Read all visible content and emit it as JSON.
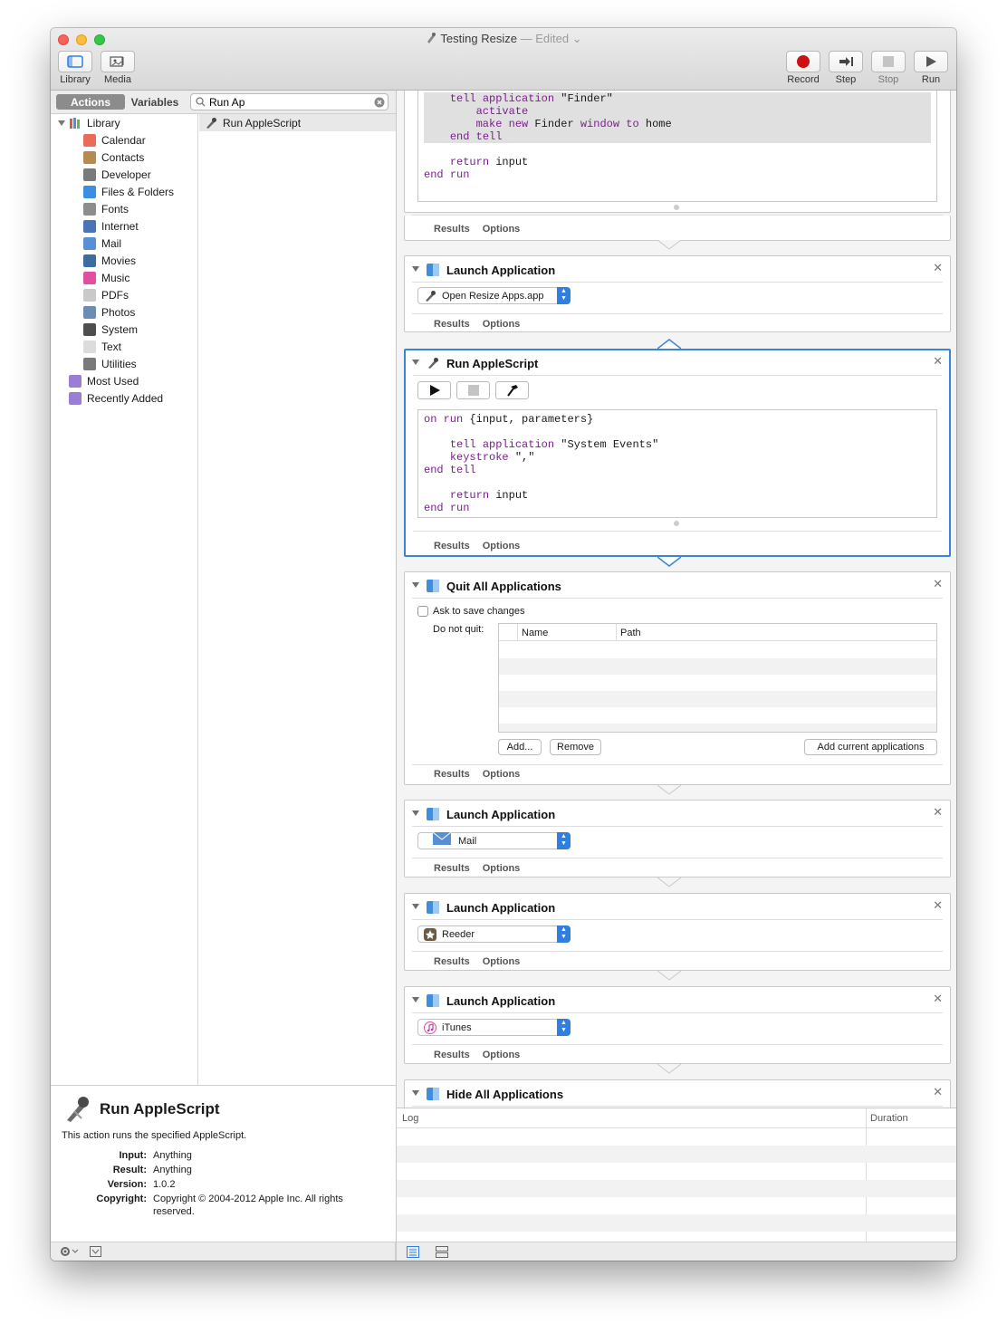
{
  "window": {
    "title": "Testing Resize",
    "edited_label": "— Edited",
    "edited_chevron": "⌄"
  },
  "toolbar": {
    "library_label": "Library",
    "media_label": "Media",
    "record_label": "Record",
    "step_label": "Step",
    "stop_label": "Stop",
    "run_label": "Run",
    "record_color": "#cc1111"
  },
  "left_header": {
    "actions_tab": "Actions",
    "variables_tab": "Variables",
    "search_value": "Run Ap"
  },
  "library": {
    "root_label": "Library",
    "items": [
      {
        "label": "Calendar",
        "icon": "calendar-icon",
        "color": "#e96c5a"
      },
      {
        "label": "Contacts",
        "icon": "contacts-icon",
        "color": "#b68a53"
      },
      {
        "label": "Developer",
        "icon": "developer-icon",
        "color": "#7a7a7a"
      },
      {
        "label": "Files & Folders",
        "icon": "finder-icon",
        "color": "#3c8ee0"
      },
      {
        "label": "Fonts",
        "icon": "fonts-icon",
        "color": "#8d8d8d"
      },
      {
        "label": "Internet",
        "icon": "internet-icon",
        "color": "#4a74b8"
      },
      {
        "label": "Mail",
        "icon": "mail-icon",
        "color": "#5a8fd6"
      },
      {
        "label": "Movies",
        "icon": "movies-icon",
        "color": "#3d6d9e"
      },
      {
        "label": "Music",
        "icon": "music-icon",
        "color": "#e24fa0"
      },
      {
        "label": "PDFs",
        "icon": "pdf-icon",
        "color": "#c9c9c9"
      },
      {
        "label": "Photos",
        "icon": "photos-icon",
        "color": "#6b8db4"
      },
      {
        "label": "System",
        "icon": "system-icon",
        "color": "#4e4e4e"
      },
      {
        "label": "Text",
        "icon": "text-icon",
        "color": "#dcdcdc"
      },
      {
        "label": "Utilities",
        "icon": "utilities-icon",
        "color": "#7a7a7a"
      }
    ],
    "smart_groups": [
      {
        "label": "Most Used",
        "icon": "smart-folder-icon",
        "color": "#9a7ed6"
      },
      {
        "label": "Recently Added",
        "icon": "smart-folder-icon",
        "color": "#9a7ed6"
      }
    ]
  },
  "actions_list": [
    {
      "label": "Run AppleScript",
      "icon": "applescript-icon"
    }
  ],
  "description": {
    "title": "Run AppleScript",
    "text": "This action runs the specified AppleScript.",
    "input_key": "Input:",
    "input_val": "Anything",
    "result_key": "Result:",
    "result_val": "Anything",
    "version_key": "Version:",
    "version_val": "1.0.2",
    "copyright_key": "Copyright:",
    "copyright_val_1": "Copyright © 2004-2012 Apple Inc.  All rights",
    "copyright_val_2": "reserved."
  },
  "workflow": {
    "results_label": "Results",
    "options_label": "Options",
    "card0": {
      "code": [
        {
          "t": "    tell application \"Finder\"",
          "hl": true
        },
        {
          "t": "        activate",
          "hl": true
        },
        {
          "t": "        make new Finder window to home",
          "hl": true
        },
        {
          "t": "    end tell",
          "hl": true
        },
        {
          "t": "",
          "hl": false
        },
        {
          "t": "    return input",
          "hl": false
        },
        {
          "t": "end run",
          "hl": false
        }
      ]
    },
    "card1": {
      "title": "Launch Application",
      "app": "Open Resize Apps.app"
    },
    "card2": {
      "title": "Run AppleScript",
      "code": [
        "on run {input, parameters}",
        "",
        "    tell application \"System Events\"",
        "    keystroke \",\"",
        "end tell",
        "",
        "    return input",
        "end run"
      ]
    },
    "card3": {
      "title": "Quit All Applications",
      "ask_label": "Ask to save changes",
      "ask_checked": false,
      "do_not_quit_label": "Do not quit:",
      "col_name": "Name",
      "col_path": "Path",
      "add_label": "Add...",
      "remove_label": "Remove",
      "add_current_label": "Add current applications"
    },
    "card4": {
      "title": "Launch Application",
      "app": "Mail"
    },
    "card5": {
      "title": "Launch Application",
      "app": "Reeder"
    },
    "card6": {
      "title": "Launch Application",
      "app": "iTunes"
    },
    "card7": {
      "title": "Hide All Applications"
    }
  },
  "log": {
    "col_log": "Log",
    "col_duration": "Duration"
  },
  "accent_color": "#3a86d6"
}
